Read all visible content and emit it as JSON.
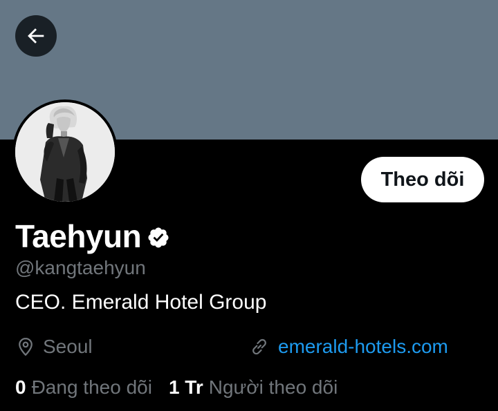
{
  "colors": {
    "banner": "#657786",
    "background": "#000000",
    "primary_text": "#ffffff",
    "secondary_text": "#71767b",
    "link": "#1d9bf0",
    "follow_button_bg": "#ffffff",
    "follow_button_text": "#0f1419"
  },
  "header": {
    "back_icon": "arrow-left-icon"
  },
  "profile": {
    "avatar": "profile-photo",
    "follow_label": "Theo dõi",
    "display_name": "Taehyun",
    "verified_icon": "verified-badge-icon",
    "handle": "@kangtaehyun",
    "bio": "CEO. Emerald Hotel Group",
    "location_icon": "location-pin-icon",
    "location": "Seoul",
    "link_icon": "link-icon",
    "website": "emerald-hotels.com",
    "following_count": "0",
    "following_label": "Đang theo dõi",
    "followers_count": "1 Tr",
    "followers_label": "Người theo dõi"
  }
}
